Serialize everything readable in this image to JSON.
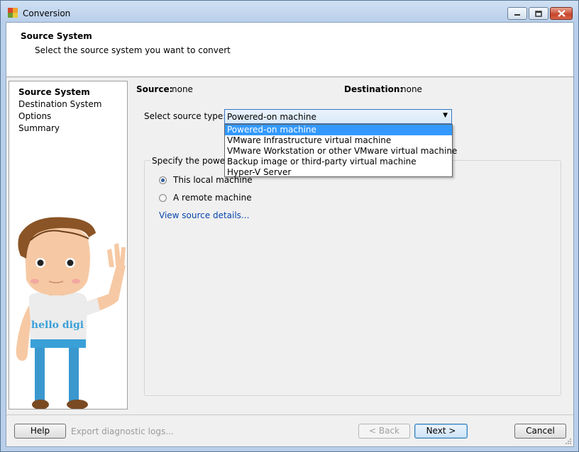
{
  "window": {
    "title": "Conversion"
  },
  "header": {
    "title": "Source System",
    "subtitle": "Select the source system you want to convert"
  },
  "nav": {
    "items": [
      "Source System",
      "Destination System",
      "Options",
      "Summary"
    ],
    "active": 0
  },
  "mascot": {
    "shirt_text": "hello digi"
  },
  "summary": {
    "source_label": "Source:",
    "source_value": "none",
    "destination_label": "Destination:",
    "destination_value": "none"
  },
  "source_type": {
    "label": "Select source type:",
    "selected": "Powered-on machine",
    "options": [
      "Powered-on machine",
      "VMware Infrastructure virtual machine",
      "VMware Workstation or other VMware virtual machine",
      "Backup image or third-party virtual machine",
      "Hyper-V Server"
    ]
  },
  "group": {
    "caption": "Specify the powere",
    "radios": [
      {
        "label": "This local machine",
        "checked": true
      },
      {
        "label": "A remote machine",
        "checked": false
      }
    ],
    "link": "View source details..."
  },
  "footer": {
    "help": "Help",
    "export": "Export diagnostic logs...",
    "back": "< Back",
    "next": "Next >",
    "cancel": "Cancel"
  },
  "colors": {
    "selection": "#3399ff",
    "link": "#0645ad",
    "mascot_blue": "#3aa0d8"
  }
}
